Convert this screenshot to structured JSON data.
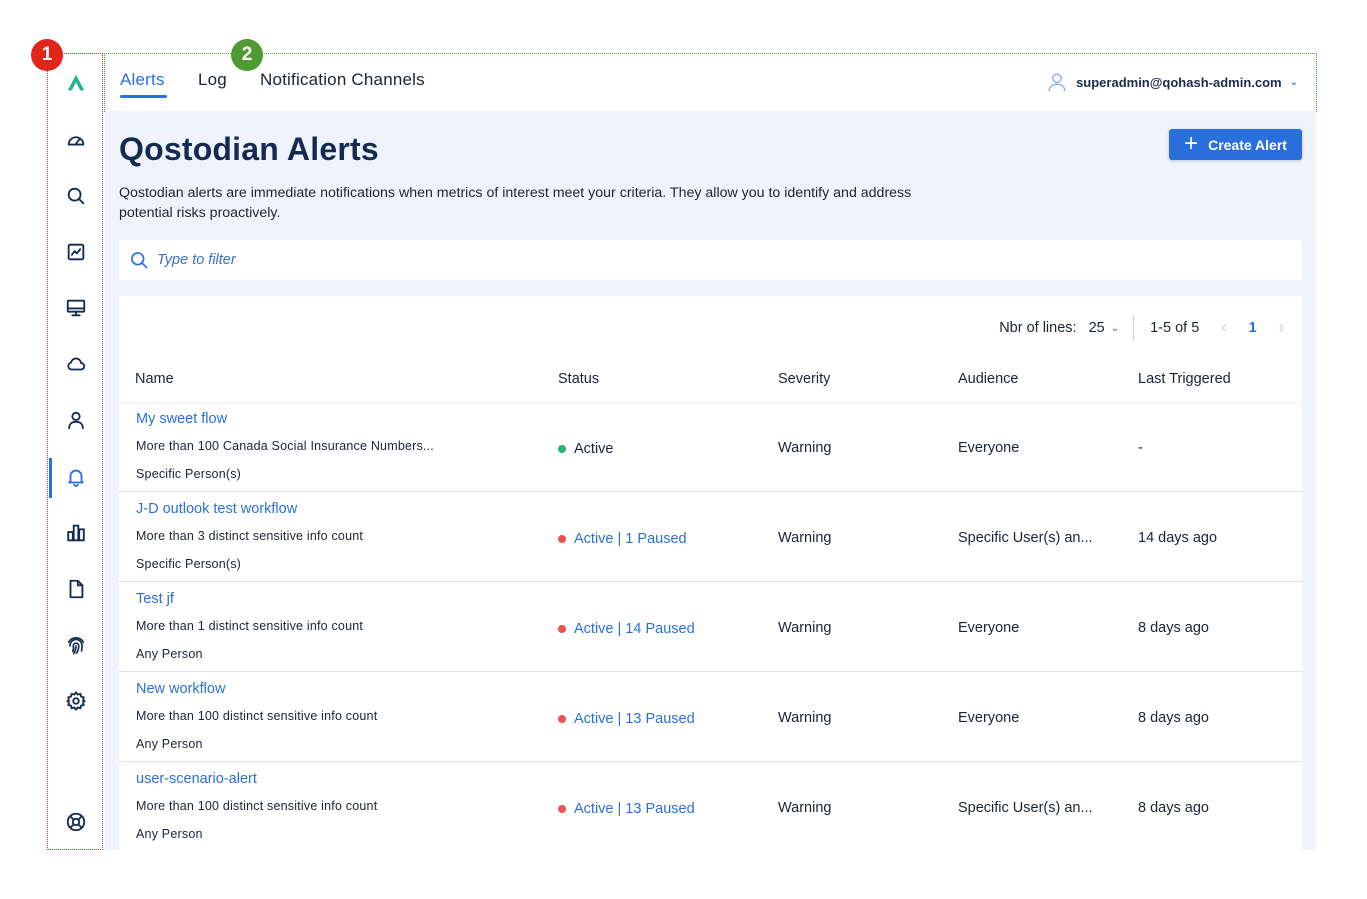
{
  "callouts": {
    "one": "1",
    "two": "2"
  },
  "sidebar": {
    "items": [
      {
        "icon": "logo-icon"
      },
      {
        "icon": "dashboard-icon"
      },
      {
        "icon": "search-icon"
      },
      {
        "icon": "chart-icon"
      },
      {
        "icon": "monitor-icon"
      },
      {
        "icon": "cloud-icon"
      },
      {
        "icon": "user-icon"
      },
      {
        "icon": "bell-icon",
        "active": true
      },
      {
        "icon": "bar-chart-icon"
      },
      {
        "icon": "document-icon"
      },
      {
        "icon": "fingerprint-icon"
      },
      {
        "icon": "gear-icon"
      },
      {
        "icon": "help-icon"
      }
    ]
  },
  "topnav": {
    "tabs": [
      {
        "label": "Alerts",
        "active": true
      },
      {
        "label": "Log"
      },
      {
        "label": "Notification Channels"
      }
    ],
    "user": "superadmin@qohash-admin.com"
  },
  "page": {
    "title": "Qostodian Alerts",
    "create_label": "Create Alert",
    "description": "Qostodian alerts are immediate notifications when metrics of interest meet your criteria. They allow you to identify and address potential risks proactively.",
    "filter_placeholder": "Type to filter"
  },
  "pager": {
    "lines_label": "Nbr of lines:",
    "lines_value": "25",
    "range": "1-5 of 5",
    "page": "1"
  },
  "table": {
    "columns": [
      "Name",
      "Status",
      "Severity",
      "Audience",
      "Last Triggered"
    ],
    "rows": [
      {
        "name": "My sweet flow",
        "desc": "More than 100 Canada Social Insurance Numbers...",
        "who": "Specific Person(s)",
        "status": "Active",
        "status_color": "#22b573",
        "severity": "Warning",
        "audience": "Everyone",
        "last": "-"
      },
      {
        "name": "J-D outlook test workflow",
        "desc": "More than 3 distinct sensitive info count",
        "who": "Specific Person(s)",
        "status": "Active | 1 Paused",
        "status_color": "#ef5350",
        "severity": "Warning",
        "audience": "Specific User(s) an...",
        "last": "14 days ago"
      },
      {
        "name": "Test jf",
        "desc": "More than 1 distinct sensitive info count",
        "who": "Any Person",
        "status": "Active | 14 Paused",
        "status_color": "#ef5350",
        "severity": "Warning",
        "audience": "Everyone",
        "last": "8 days ago"
      },
      {
        "name": "New workflow",
        "desc": "More than 100 distinct sensitive info count",
        "who": "Any Person",
        "status": "Active | 13 Paused",
        "status_color": "#ef5350",
        "severity": "Warning",
        "audience": "Everyone",
        "last": "8 days ago"
      },
      {
        "name": "user-scenario-alert",
        "desc": "More than 100 distinct sensitive info count",
        "who": "Any Person",
        "status": "Active | 13 Paused",
        "status_color": "#ef5350",
        "severity": "Warning",
        "audience": "Specific User(s) an...",
        "last": "8 days ago"
      }
    ]
  },
  "colors": {
    "accent": "#2b6fdc",
    "active_dot": "#22b573",
    "paused_dot": "#ef5350",
    "title": "#142a52"
  }
}
